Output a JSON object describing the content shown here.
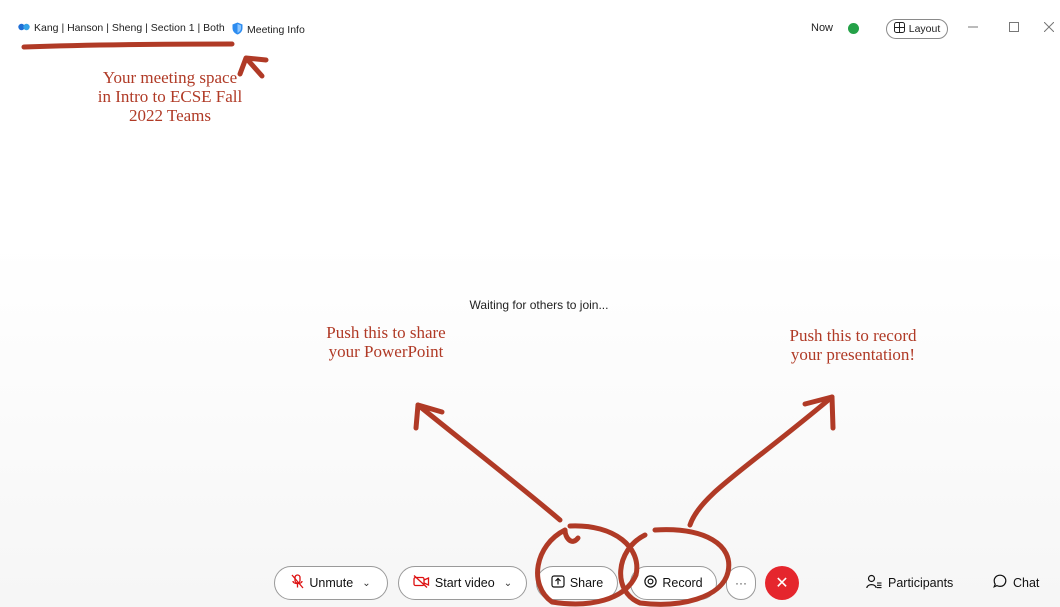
{
  "header": {
    "meeting_title": "Kang | Hanson | Sheng | Section 1 | Both",
    "meeting_info_label": "Meeting Info",
    "timer": "Now",
    "layout_label": "Layout"
  },
  "main": {
    "waiting_text": "Waiting for others to join..."
  },
  "toolbar": {
    "unmute_label": "Unmute",
    "start_video_label": "Start video",
    "share_label": "Share",
    "record_label": "Record",
    "more_label": "···",
    "end_label": "✕",
    "participants_label": "Participants",
    "chat_label": "Chat"
  },
  "annotations": {
    "meeting_space": [
      "Your meeting space",
      "in Intro to ECSE Fall",
      "2022 Teams"
    ],
    "share_hint": [
      "Push this to share",
      "your PowerPoint"
    ],
    "record_hint": [
      "Push this to record",
      "your presentation!"
    ]
  },
  "colors": {
    "annotation_ink": "#b03a26",
    "end_call": "#e5262d",
    "signal": "#24a148",
    "shield": "#2d8cf0"
  }
}
